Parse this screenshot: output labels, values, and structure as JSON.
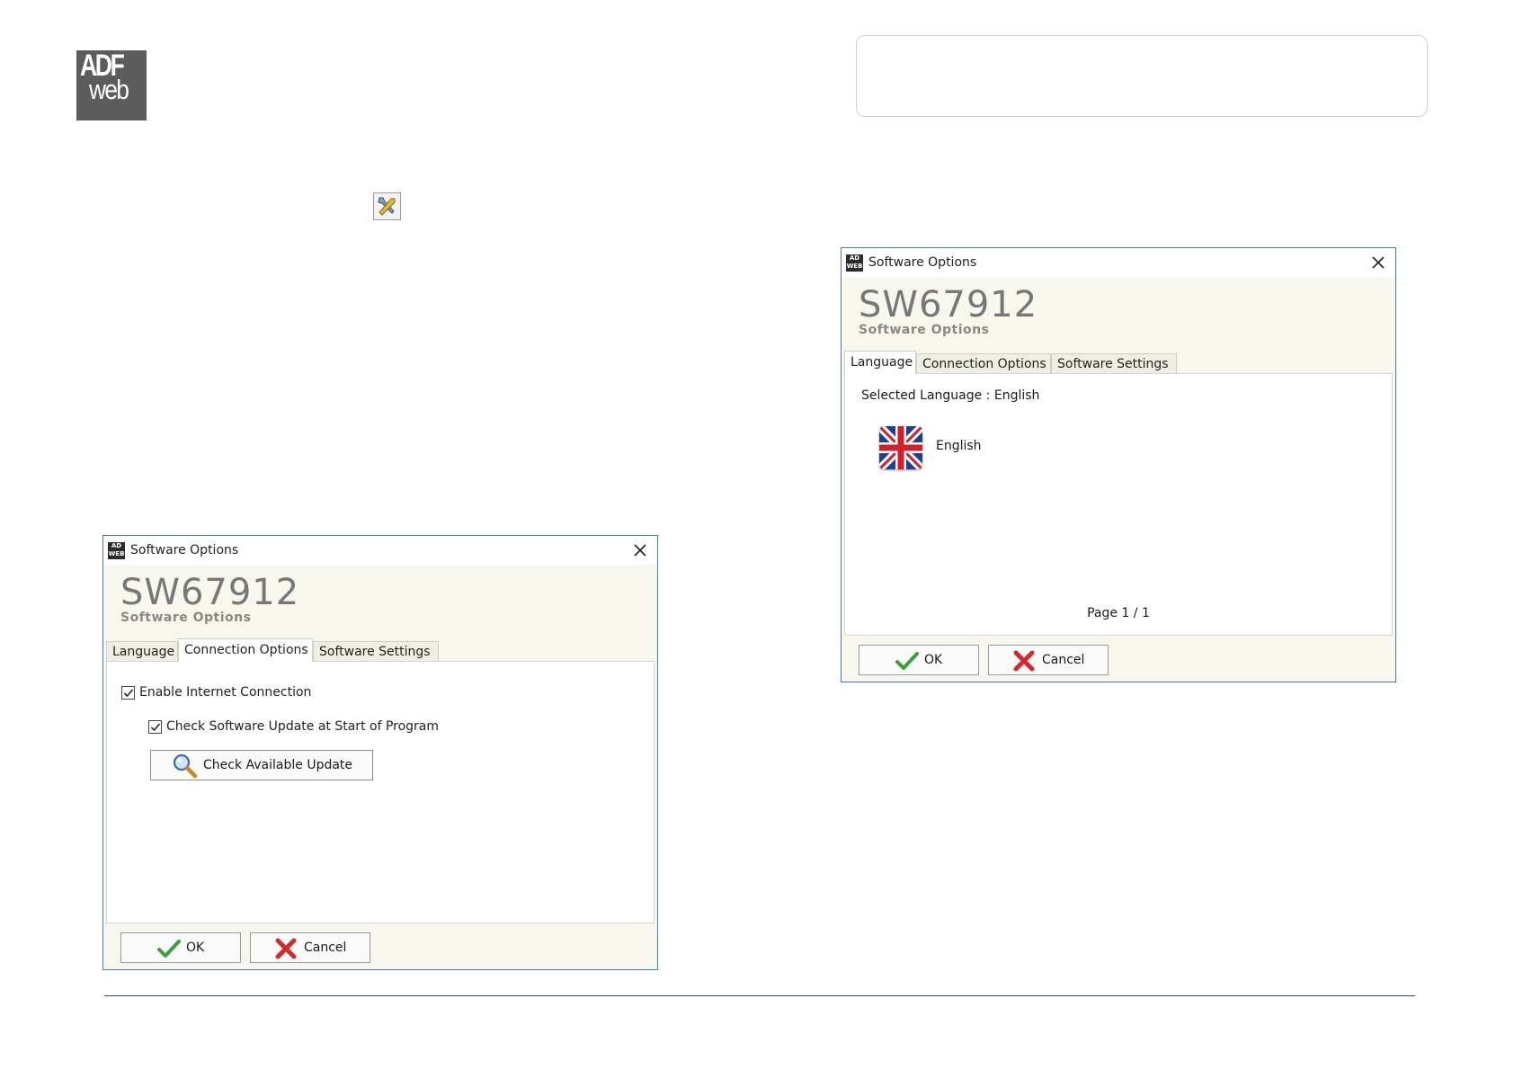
{
  "logo": {
    "line1": "ADF",
    "line2": "web"
  },
  "icons": {
    "tool": "wrench-screwdriver-icon"
  },
  "colors": {
    "dialog_border": "#3d7ec9",
    "dialog_bg": "#f8f7ee",
    "footer_line": "#2f4f7f",
    "accent_check": "#3aa13a",
    "cancel_red": "#d42a2a"
  },
  "dialog_connection": {
    "title": "Software Options",
    "product": "SW67912",
    "subtitle": "Software Options",
    "tabs": [
      "Language",
      "Connection Options",
      "Software Settings"
    ],
    "active_tab": "Connection Options",
    "enable_internet_label": "Enable Internet Connection",
    "check_update_label": "Check Software Update at Start of Program",
    "check_available_label": "Check Available Update",
    "ok_label": "OK",
    "cancel_label": "Cancel"
  },
  "dialog_language": {
    "title": "Software Options",
    "product": "SW67912",
    "subtitle": "Software Options",
    "tabs": [
      "Language",
      "Connection Options",
      "Software Settings"
    ],
    "active_tab": "Language",
    "selected_language": "Selected Language : English",
    "language_option": "English",
    "page_info": "Page 1 / 1",
    "ok_label": "OK",
    "cancel_label": "Cancel"
  }
}
